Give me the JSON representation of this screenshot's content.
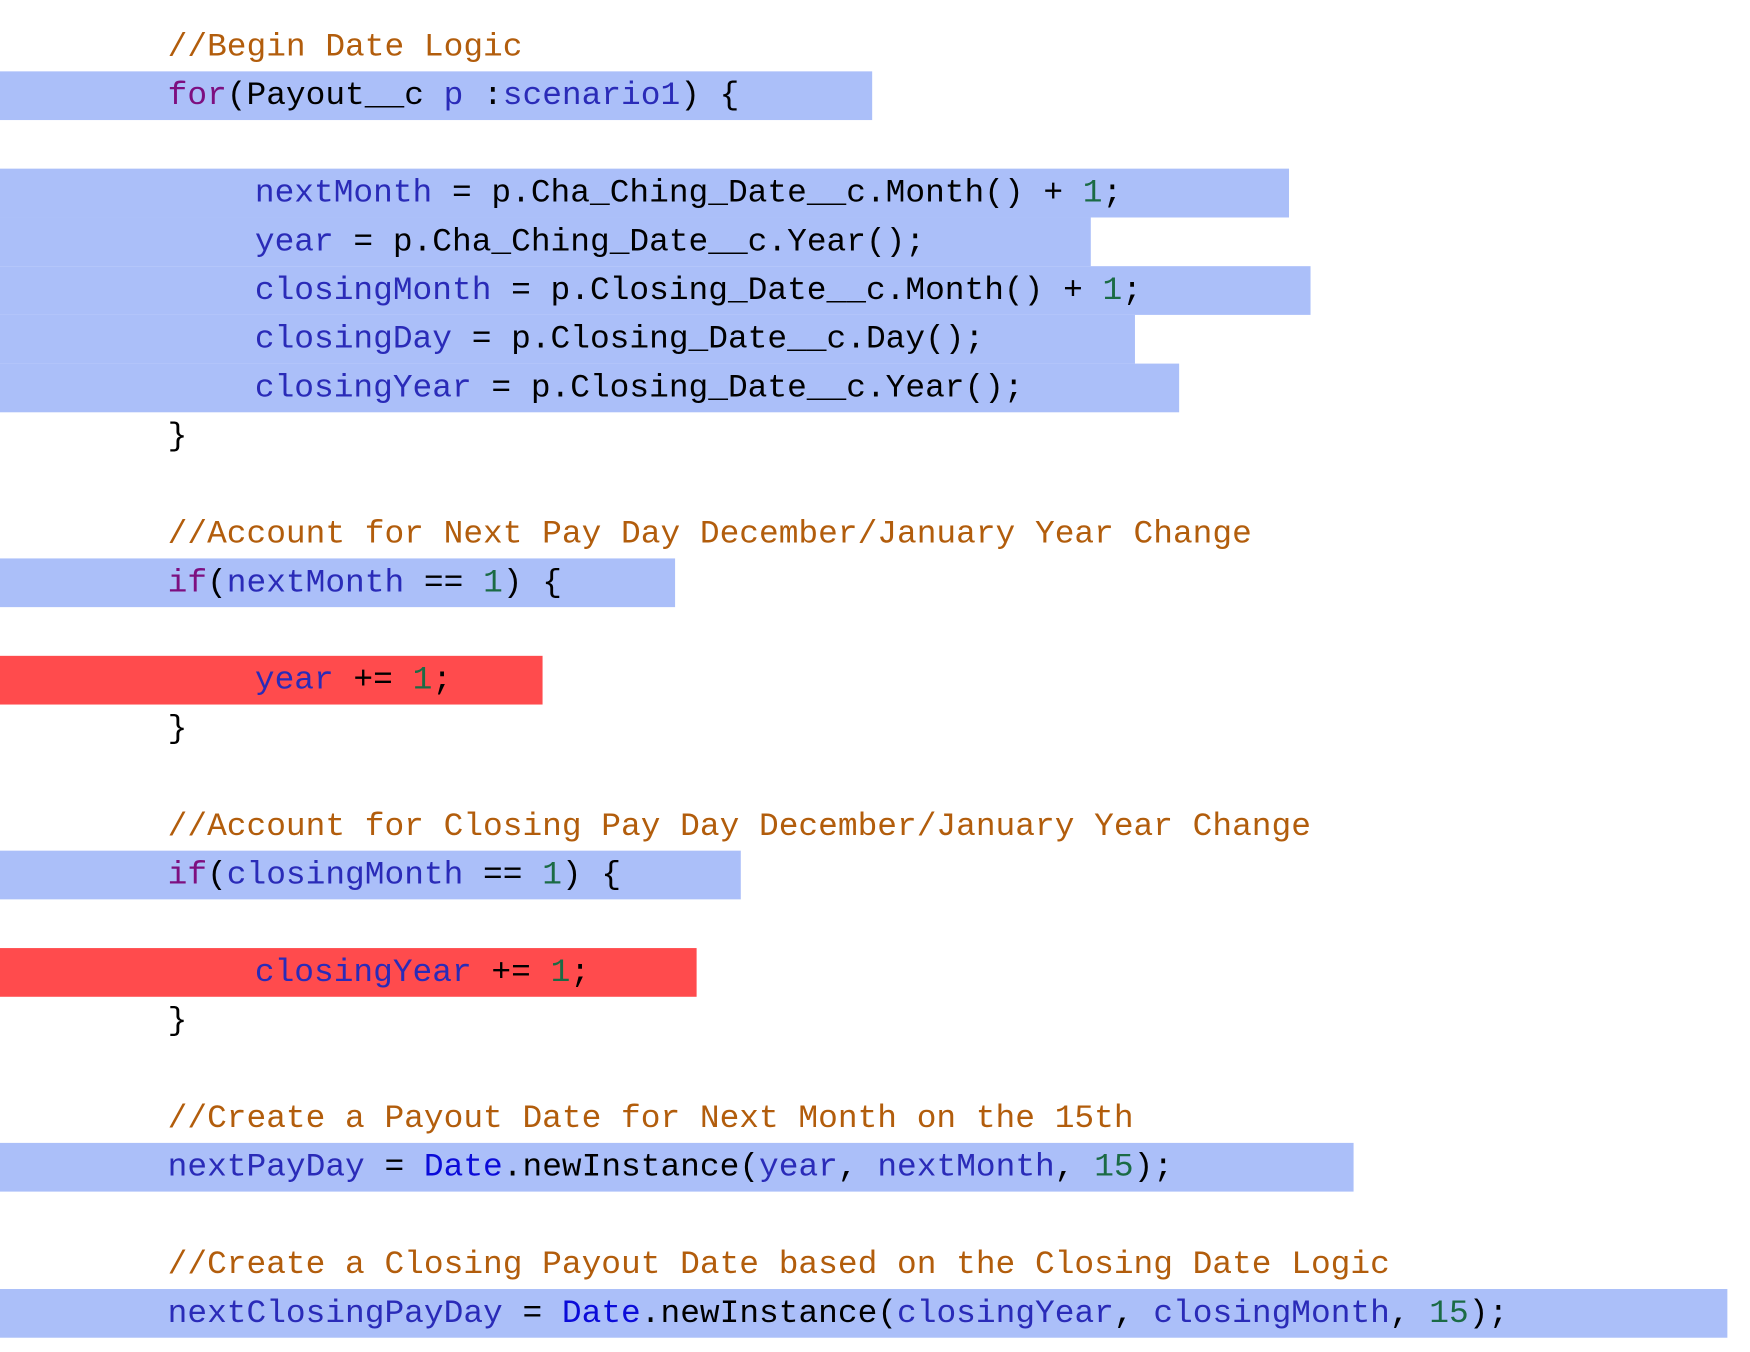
{
  "colors": {
    "highlight_blue": "#abbff9",
    "highlight_red": "#ff4b4d",
    "comment": "#b25d0c",
    "keyword": "#7d0f80",
    "identifier": "#2a2bb8",
    "type": "#0b0bd8",
    "number": "#1b6b45",
    "plain": "#000000"
  },
  "code": {
    "lines": [
      {
        "row": 0,
        "indent": 1,
        "highlight": "none",
        "tokens": [
          {
            "t": "comment",
            "v": "//Begin Date Logic"
          }
        ]
      },
      {
        "row": 1,
        "indent": 1,
        "highlight": "blue",
        "tokens": [
          {
            "t": "keyword",
            "v": "for"
          },
          {
            "t": "plain",
            "v": "(Payout__c "
          },
          {
            "t": "ident",
            "v": "p"
          },
          {
            "t": "plain",
            "v": " :"
          },
          {
            "t": "ident",
            "v": "scenario1"
          },
          {
            "t": "plain",
            "v": ") {"
          }
        ]
      },
      {
        "row": 2,
        "indent": 0,
        "highlight": "blue",
        "tokens": []
      },
      {
        "row": 3,
        "indent": 2,
        "highlight": "blue",
        "tokens": [
          {
            "t": "ident",
            "v": "nextMonth"
          },
          {
            "t": "plain",
            "v": " = p.Cha_Ching_Date__c.Month() + "
          },
          {
            "t": "num",
            "v": "1"
          },
          {
            "t": "plain",
            "v": ";"
          }
        ]
      },
      {
        "row": 4,
        "indent": 2,
        "highlight": "blue",
        "tokens": [
          {
            "t": "ident",
            "v": "year"
          },
          {
            "t": "plain",
            "v": " = p.Cha_Ching_Date__c.Year();"
          }
        ]
      },
      {
        "row": 5,
        "indent": 2,
        "highlight": "blue",
        "tokens": [
          {
            "t": "ident",
            "v": "closingMonth"
          },
          {
            "t": "plain",
            "v": " = p.Closing_Date__c.Month() + "
          },
          {
            "t": "num",
            "v": "1"
          },
          {
            "t": "plain",
            "v": ";"
          }
        ]
      },
      {
        "row": 6,
        "indent": 2,
        "highlight": "blue",
        "tokens": [
          {
            "t": "ident",
            "v": "closingDay"
          },
          {
            "t": "plain",
            "v": " = p.Closing_Date__c.Day();"
          }
        ]
      },
      {
        "row": 7,
        "indent": 2,
        "highlight": "blue",
        "tokens": [
          {
            "t": "ident",
            "v": "closingYear"
          },
          {
            "t": "plain",
            "v": " = p.Closing_Date__c.Year();"
          }
        ]
      },
      {
        "row": 8,
        "indent": 1,
        "highlight": "none",
        "tokens": [
          {
            "t": "plain",
            "v": "}"
          }
        ]
      },
      {
        "row": 10,
        "indent": 1,
        "highlight": "none",
        "tokens": [
          {
            "t": "comment",
            "v": "//Account for Next Pay Day December/January Year Change"
          }
        ]
      },
      {
        "row": 11,
        "indent": 1,
        "highlight": "blue",
        "tokens": [
          {
            "t": "keyword",
            "v": "if"
          },
          {
            "t": "plain",
            "v": "("
          },
          {
            "t": "ident",
            "v": "nextMonth"
          },
          {
            "t": "plain",
            "v": " == "
          },
          {
            "t": "num",
            "v": "1"
          },
          {
            "t": "plain",
            "v": ") {"
          }
        ]
      },
      {
        "row": 13,
        "indent": 2,
        "highlight": "red",
        "tokens": [
          {
            "t": "ident",
            "v": "year"
          },
          {
            "t": "plain",
            "v": " += "
          },
          {
            "t": "num",
            "v": "1"
          },
          {
            "t": "plain",
            "v": ";"
          }
        ]
      },
      {
        "row": 14,
        "indent": 1,
        "highlight": "none",
        "tokens": [
          {
            "t": "plain",
            "v": "}"
          }
        ]
      },
      {
        "row": 16,
        "indent": 1,
        "highlight": "none",
        "tokens": [
          {
            "t": "comment",
            "v": "//Account for Closing Pay Day December/January Year Change"
          }
        ]
      },
      {
        "row": 17,
        "indent": 1,
        "highlight": "blue",
        "tokens": [
          {
            "t": "keyword",
            "v": "if"
          },
          {
            "t": "plain",
            "v": "("
          },
          {
            "t": "ident",
            "v": "closingMonth"
          },
          {
            "t": "plain",
            "v": " == "
          },
          {
            "t": "num",
            "v": "1"
          },
          {
            "t": "plain",
            "v": ") {"
          }
        ]
      },
      {
        "row": 19,
        "indent": 2,
        "highlight": "red",
        "tokens": [
          {
            "t": "ident",
            "v": "closingYear"
          },
          {
            "t": "plain",
            "v": " += "
          },
          {
            "t": "num",
            "v": "1"
          },
          {
            "t": "plain",
            "v": ";"
          }
        ]
      },
      {
        "row": 20,
        "indent": 1,
        "highlight": "none",
        "tokens": [
          {
            "t": "plain",
            "v": "}"
          }
        ]
      },
      {
        "row": 22,
        "indent": 1,
        "highlight": "none",
        "tokens": [
          {
            "t": "comment",
            "v": "//Create a Payout Date for Next Month on the 15th"
          }
        ]
      },
      {
        "row": 23,
        "indent": 1,
        "highlight": "blue",
        "tokens": [
          {
            "t": "ident",
            "v": "nextPayDay"
          },
          {
            "t": "plain",
            "v": " = "
          },
          {
            "t": "type",
            "v": "Date"
          },
          {
            "t": "plain",
            "v": ".newInstance("
          },
          {
            "t": "ident",
            "v": "year"
          },
          {
            "t": "plain",
            "v": ", "
          },
          {
            "t": "ident",
            "v": "nextMonth"
          },
          {
            "t": "plain",
            "v": ", "
          },
          {
            "t": "num",
            "v": "15"
          },
          {
            "t": "plain",
            "v": ");"
          }
        ]
      },
      {
        "row": 25,
        "indent": 1,
        "highlight": "none",
        "tokens": [
          {
            "t": "comment",
            "v": "//Create a Closing Payout Date based on the Closing Date Logic"
          }
        ]
      },
      {
        "row": 26,
        "indent": 1,
        "highlight": "blue",
        "tokens": [
          {
            "t": "ident",
            "v": "nextClosingPayDay"
          },
          {
            "t": "plain",
            "v": " = "
          },
          {
            "t": "type",
            "v": "Date"
          },
          {
            "t": "plain",
            "v": ".newInstance("
          },
          {
            "t": "ident",
            "v": "closingYear"
          },
          {
            "t": "plain",
            "v": ", "
          },
          {
            "t": "ident",
            "v": "closingMonth"
          },
          {
            "t": "plain",
            "v": ", "
          },
          {
            "t": "num",
            "v": "15"
          },
          {
            "t": "plain",
            "v": ");"
          }
        ]
      }
    ]
  }
}
